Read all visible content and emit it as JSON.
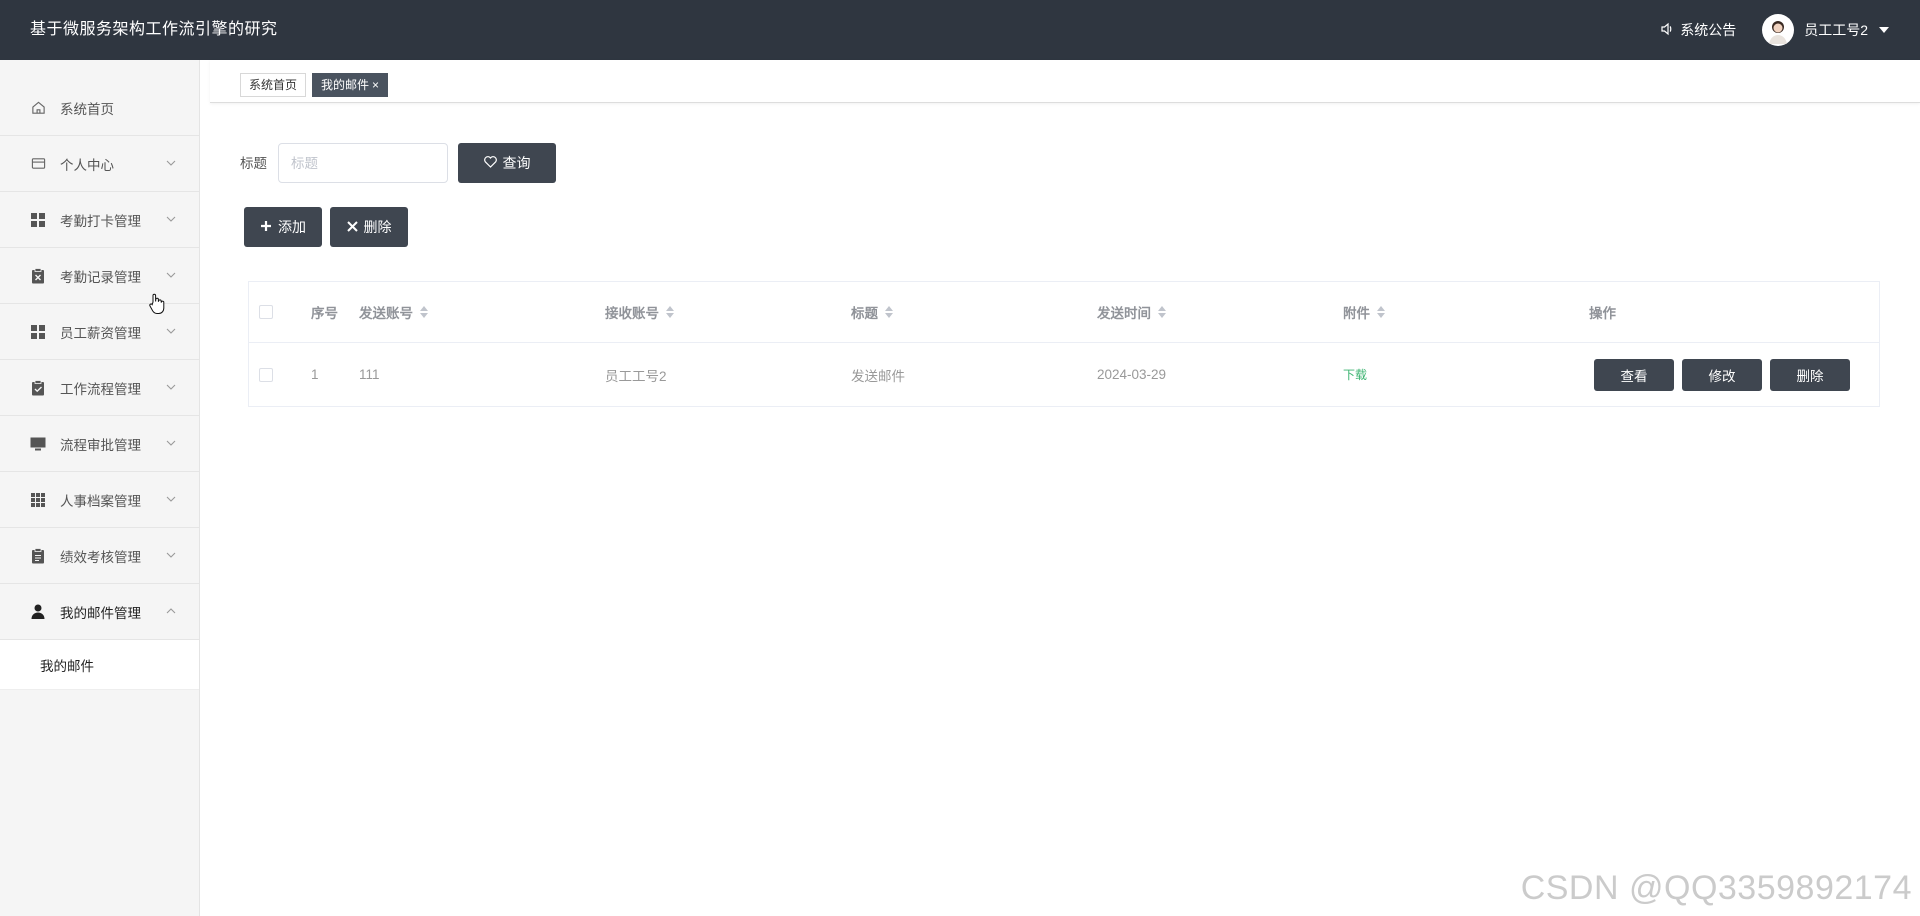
{
  "header": {
    "app_title": "基于微服务架构工作流引擎的研究",
    "notice_label": "系统公告",
    "user_name": "员工工号2"
  },
  "sidebar": {
    "items": [
      {
        "label": "系统首页",
        "icon": "home-icon"
      },
      {
        "label": "个人中心",
        "icon": "card-icon"
      },
      {
        "label": "考勤打卡管理",
        "icon": "grid-icon"
      },
      {
        "label": "考勤记录管理",
        "icon": "clipboard-x-icon"
      },
      {
        "label": "员工薪资管理",
        "icon": "grid-icon"
      },
      {
        "label": "工作流程管理",
        "icon": "clipboard-check-icon"
      },
      {
        "label": "流程审批管理",
        "icon": "monitor-icon"
      },
      {
        "label": "人事档案管理",
        "icon": "apps-icon"
      },
      {
        "label": "绩效考核管理",
        "icon": "clipboard-icon"
      },
      {
        "label": "我的邮件管理",
        "icon": "user-icon"
      }
    ],
    "submenu": {
      "label": "我的邮件"
    }
  },
  "tabs": [
    {
      "label": "系统首页"
    },
    {
      "label": "我的邮件",
      "close": "×"
    }
  ],
  "search": {
    "label": "标题",
    "placeholder": "标题",
    "query_label": "查询"
  },
  "toolbar": {
    "add_label": "添加",
    "delete_label": "删除"
  },
  "table": {
    "columns": [
      "序号",
      "发送账号",
      "接收账号",
      "标题",
      "发送时间",
      "附件",
      "操作"
    ],
    "rows": [
      {
        "index": "1",
        "sender": "111",
        "receiver": "员工工号2",
        "title": "发送邮件",
        "send_time": "2024-03-29",
        "attachment": "下载",
        "actions": [
          "查看",
          "修改",
          "删除"
        ]
      }
    ]
  },
  "watermark": "CSDN @QQ3359892174",
  "colors": {
    "header_bg": "#2f3640",
    "button_bg": "#3f4650",
    "sidebar_bg": "#f5f5f5",
    "download_link": "#3cb371"
  }
}
